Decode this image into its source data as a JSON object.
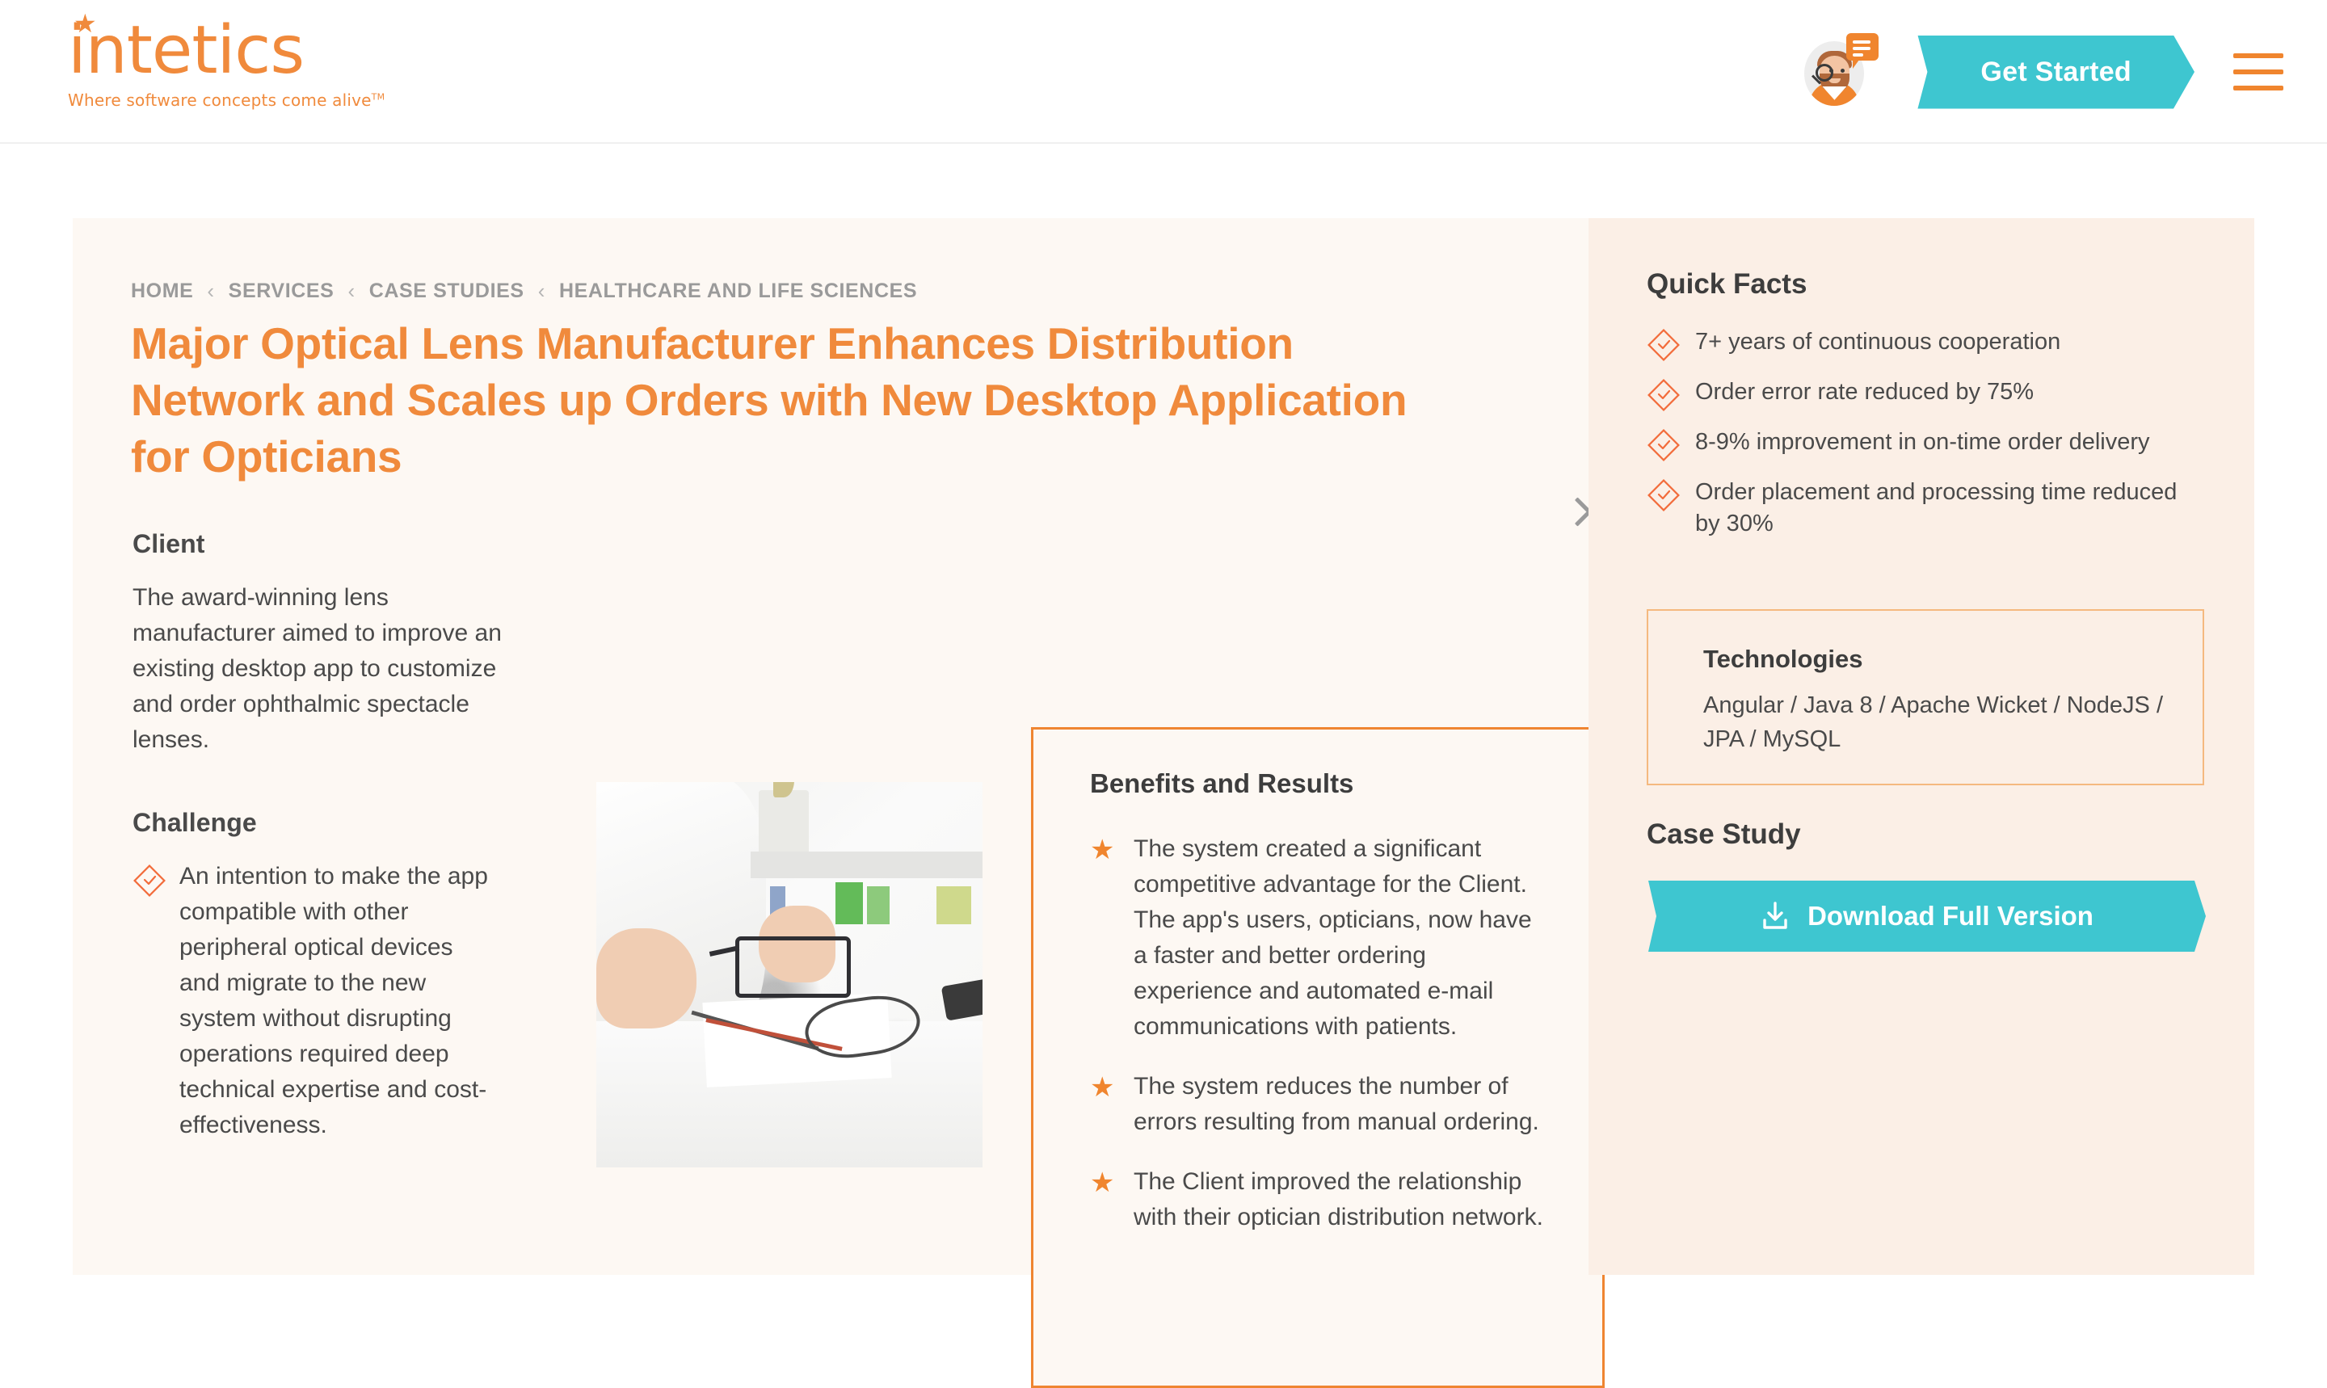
{
  "header": {
    "logo_text": "intetics",
    "logo_tagline": "Where software concepts come alive",
    "logo_tm": "TM",
    "get_started_label": "Get Started",
    "avatar_icon": "support-agent-avatar-icon",
    "chat_icon": "chat-bubble-icon",
    "menu_icon": "hamburger-menu-icon"
  },
  "breadcrumb": {
    "items": [
      "HOME",
      "SERVICES",
      "CASE STUDIES",
      "HEALTHCARE AND LIFE SCIENCES"
    ],
    "separator": "‹"
  },
  "close_icon": "close-icon",
  "case": {
    "title": "Major Optical Lens Manufacturer Enhances Distribution Network and Scales up Orders with New Desktop Application for Opticians",
    "client_heading": "Client",
    "client_text": "The award-winning lens manufacturer aimed to improve an existing desktop app to customize and order ophthalmic spectacle lenses.",
    "challenge_heading": "Challenge",
    "challenge_items": [
      "An intention to make the app compatible with other peripheral optical devices and migrate to the new system without disrupting operations required deep technical expertise and cost-effectiveness."
    ],
    "photo_alt": "optician-examining-eyeglasses-photo"
  },
  "benefits": {
    "heading": "Benefits and Results",
    "items": [
      "The system created a significant competitive advantage for the Client. The app's users, opticians, now have a faster and better ordering experience and automated e-mail communications with patients.",
      "The system reduces the number of errors resulting from manual ordering.",
      "The Client improved the relationship with their optician distribution network."
    ],
    "bullet_icon": "star-bullet-icon"
  },
  "sidebar": {
    "quick_facts_heading": "Quick Facts",
    "quick_facts": [
      "7+ years of continuous cooperation",
      "Order error rate reduced by 75%",
      "8-9% improvement in on-time order delivery",
      "Order placement and processing time reduced by 30%"
    ],
    "fact_icon": "diamond-check-icon",
    "technologies_heading": "Technologies",
    "technologies_text": "Angular / Java 8 / Apache Wicket / NodeJS / JPA / MySQL",
    "case_study_heading": "Case Study",
    "download_label": "Download Full Version",
    "download_icon": "download-icon"
  },
  "colors": {
    "brand_orange": "#f08a3c",
    "accent_teal": "#3ec6d0",
    "panel_bg": "#fdf8f3",
    "sidebar_bg": "#fbefe6",
    "text_dark": "#4a4a4a",
    "muted_gray": "#9a9a9a"
  }
}
